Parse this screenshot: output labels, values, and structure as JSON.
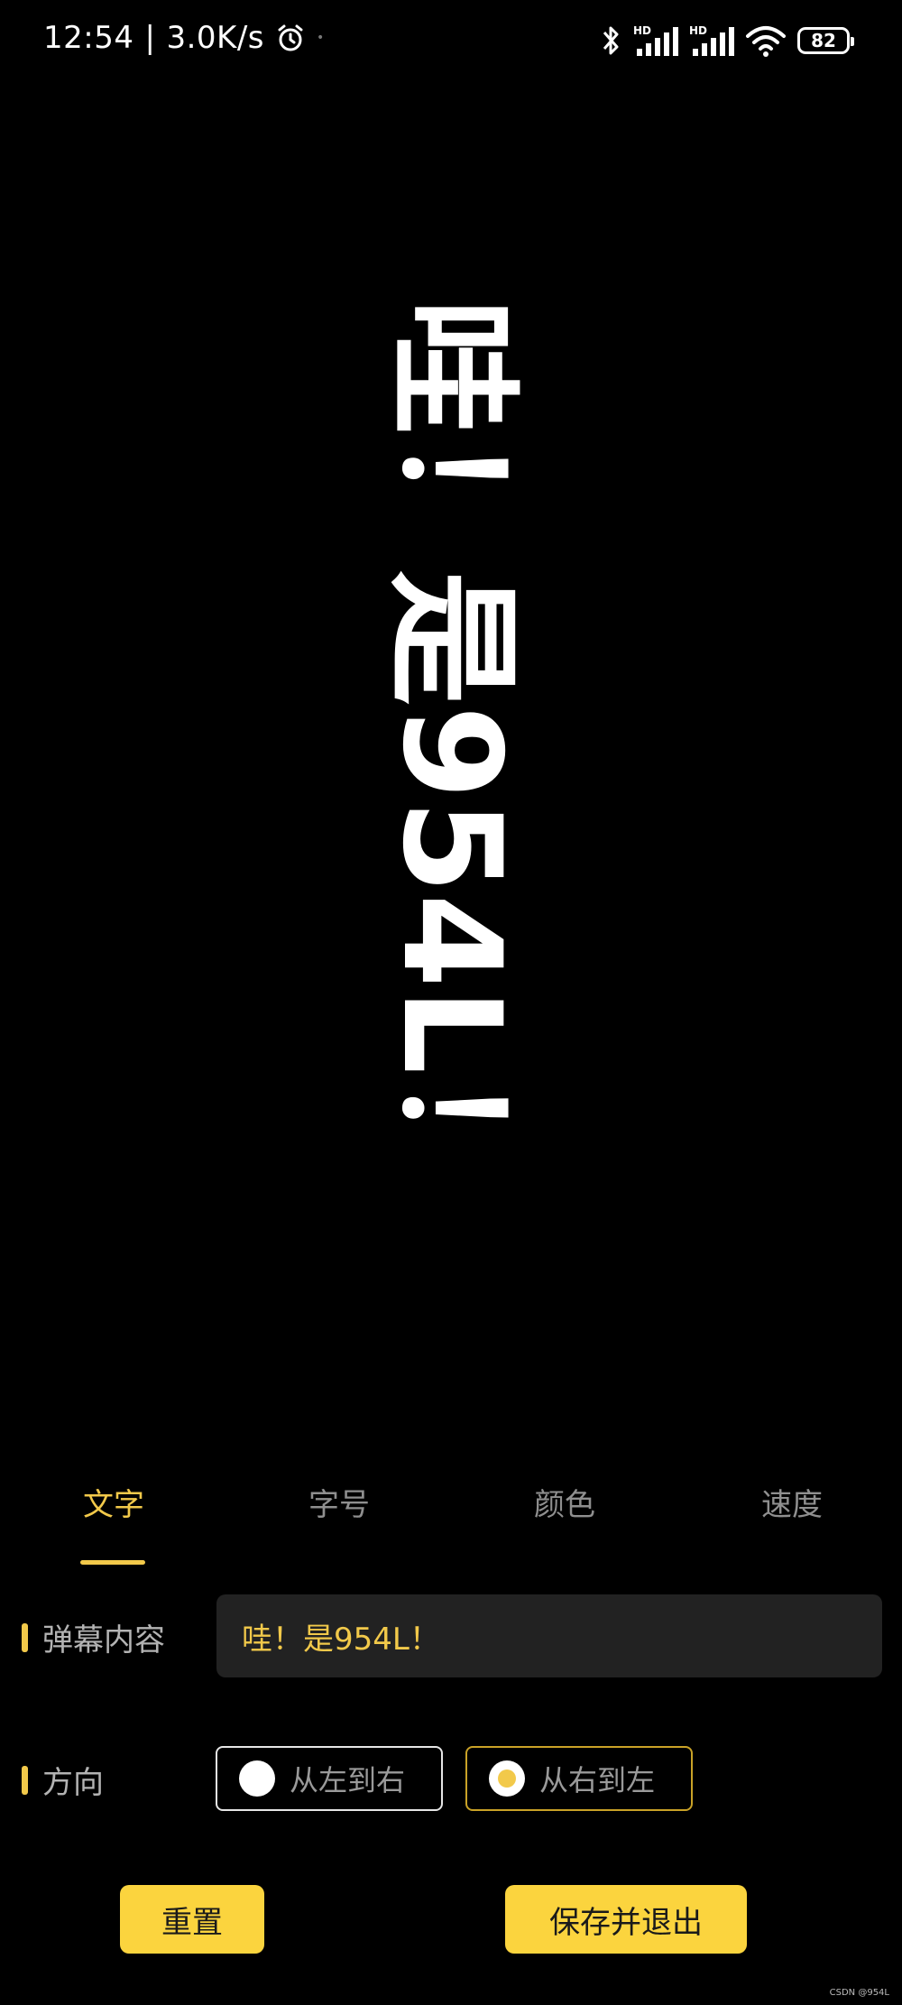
{
  "status_bar": {
    "time": "12:54",
    "separator": "|",
    "net_speed": "3.0K/s",
    "battery": "82",
    "icons": [
      "alarm-icon",
      "bluetooth-icon",
      "hd-signal-icon",
      "hd-signal-icon",
      "wifi-icon",
      "battery-icon"
    ]
  },
  "preview": {
    "text": "哇！是954L！",
    "orientation": "rotated-90",
    "color": "#ffffff"
  },
  "tabs": [
    {
      "label": "文字",
      "active": true
    },
    {
      "label": "字号",
      "active": false
    },
    {
      "label": "颜色",
      "active": false
    },
    {
      "label": "速度",
      "active": false
    }
  ],
  "content_row": {
    "label": "弹幕内容",
    "value": "哇！是954L！"
  },
  "direction_row": {
    "label": "方向",
    "options": [
      {
        "label": "从左到右",
        "selected": false
      },
      {
        "label": "从右到左",
        "selected": true
      }
    ]
  },
  "buttons": {
    "reset": "重置",
    "save": "保存并退出"
  },
  "watermark": "CSDN @954L",
  "colors": {
    "accent": "#f2c94a",
    "button_bg": "#fbd43e",
    "background": "#000000",
    "input_bg": "#222222"
  }
}
